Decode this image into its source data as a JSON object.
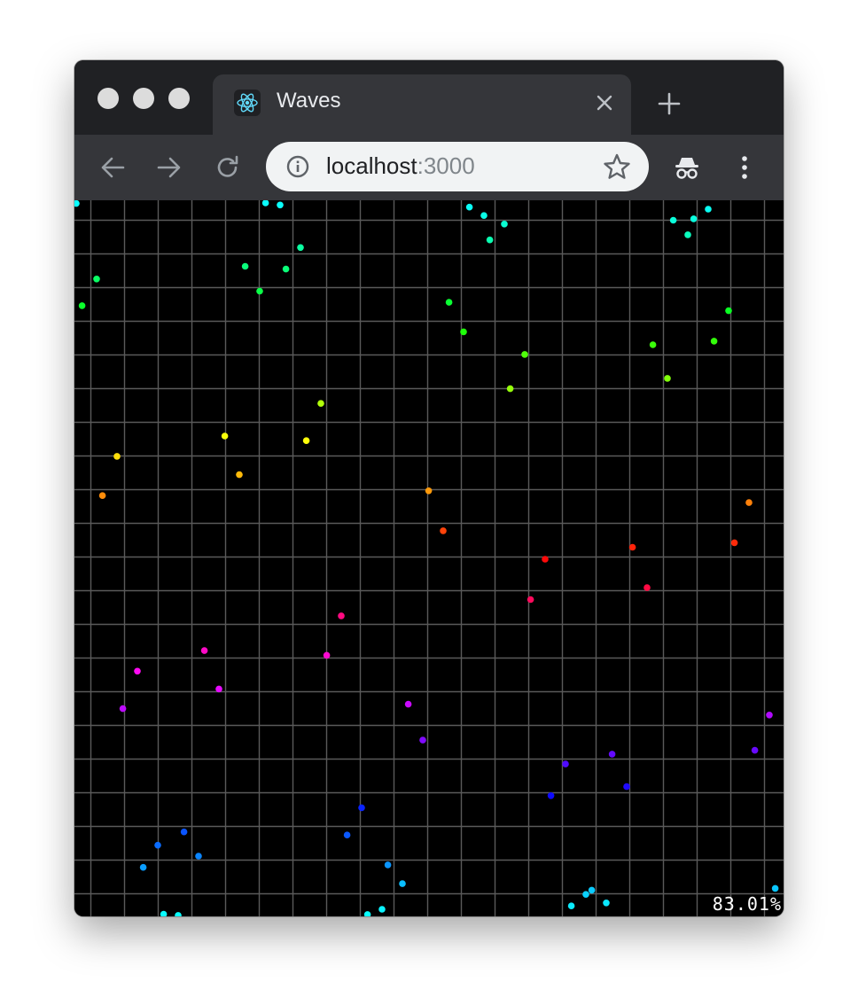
{
  "browser": {
    "tab": {
      "title": "Waves",
      "favicon": "react-logo-icon"
    },
    "url": {
      "host": "localhost",
      "port": ":3000"
    },
    "icons": [
      "back-arrow-icon",
      "forward-arrow-icon",
      "reload-icon",
      "info-icon",
      "star-icon",
      "incognito-icon",
      "more-vertical-icon",
      "close-icon",
      "plus-icon"
    ]
  },
  "app": {
    "fps_readout": "83.01%",
    "colors": {
      "background": "#000000",
      "grid": "#5a5a5a"
    }
  }
}
